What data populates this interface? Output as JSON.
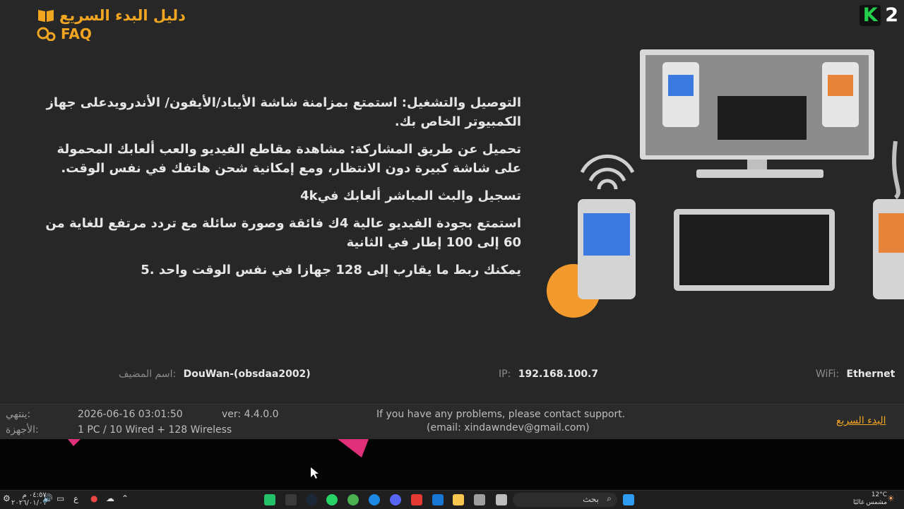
{
  "header": {
    "guide_link": "دليل البدء السريع",
    "faq_link": "FAQ"
  },
  "logo": {
    "k": "K",
    "num": "2"
  },
  "features": [
    "التوصيل والتشغيل: استمتع بمزامنة شاشة الأيباد/الأيفون/ الأندرويدعلى جهاز الكمبيوتر الخاص بك.",
    "تحميل عن طريق المشاركة: مشاهدة مقاطع الفيديو والعب ألعابك المحمولة على شاشة كبيرة دون الانتظار، ومع إمكانية شحن هاتفك في نفس الوقت.",
    "تسجيل والبث المباشر ألعابك في4k",
    "استمتع بجودة الفيديو عالية 4ك فائقة وصورة سائلة مع تردد مرتفع للغاية من 60 إلى 100 إطار في الثانية",
    "يمكنك ربط ما يقارب إلى 128 جهازا في نفس الوقت واحد .5"
  ],
  "info": {
    "host_label": "اسم المضيف:",
    "host_value": "DouWan-(obsdaa2002)",
    "ip_label": "IP:",
    "ip_value": "192.168.100.7",
    "wifi_label": "WiFi:",
    "wifi_value": "Ethernet"
  },
  "status": {
    "expires_label": "ينتهي:",
    "expires_value": "2026-06-16 03:01:50",
    "version": "ver: 4.4.0.0",
    "devices_label": "الأجهزة:",
    "devices_value": "1 PC / 10 Wired + 128 Wireless",
    "support_line1": "If you have any problems, please contact support.",
    "support_line2": "(email: xindawndev@gmail.com)",
    "guide_link": "البدء السريع"
  },
  "taskbar": {
    "search_placeholder": "بحث",
    "time": "٠٤:٥٧ م",
    "date": "٢٠٢٦/٠١/٠١",
    "weather_temp": "12°C",
    "weather_desc": "مشمس غالبًا",
    "lang": "ع"
  },
  "colors": {
    "accent": "#f2a521",
    "k2_green": "#22d04b"
  }
}
